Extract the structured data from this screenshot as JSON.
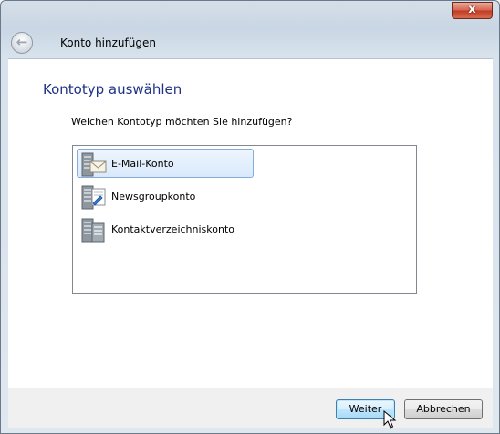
{
  "window": {
    "title": "Konto hinzufügen",
    "close_label": "x"
  },
  "nav": {
    "back_glyph": "←"
  },
  "page": {
    "heading": "Kontotyp auswählen",
    "question": "Welchen Kontotyp möchten Sie hinzufügen?"
  },
  "account_types": [
    {
      "label": "E-Mail-Konto",
      "icon": "email-server-icon",
      "selected": true
    },
    {
      "label": "Newsgroupkonto",
      "icon": "newsgroup-server-icon",
      "selected": false
    },
    {
      "label": "Kontaktverzeichniskonto",
      "icon": "directory-server-icon",
      "selected": false
    }
  ],
  "buttons": {
    "next": "Weiter",
    "cancel": "Abbrechen"
  }
}
